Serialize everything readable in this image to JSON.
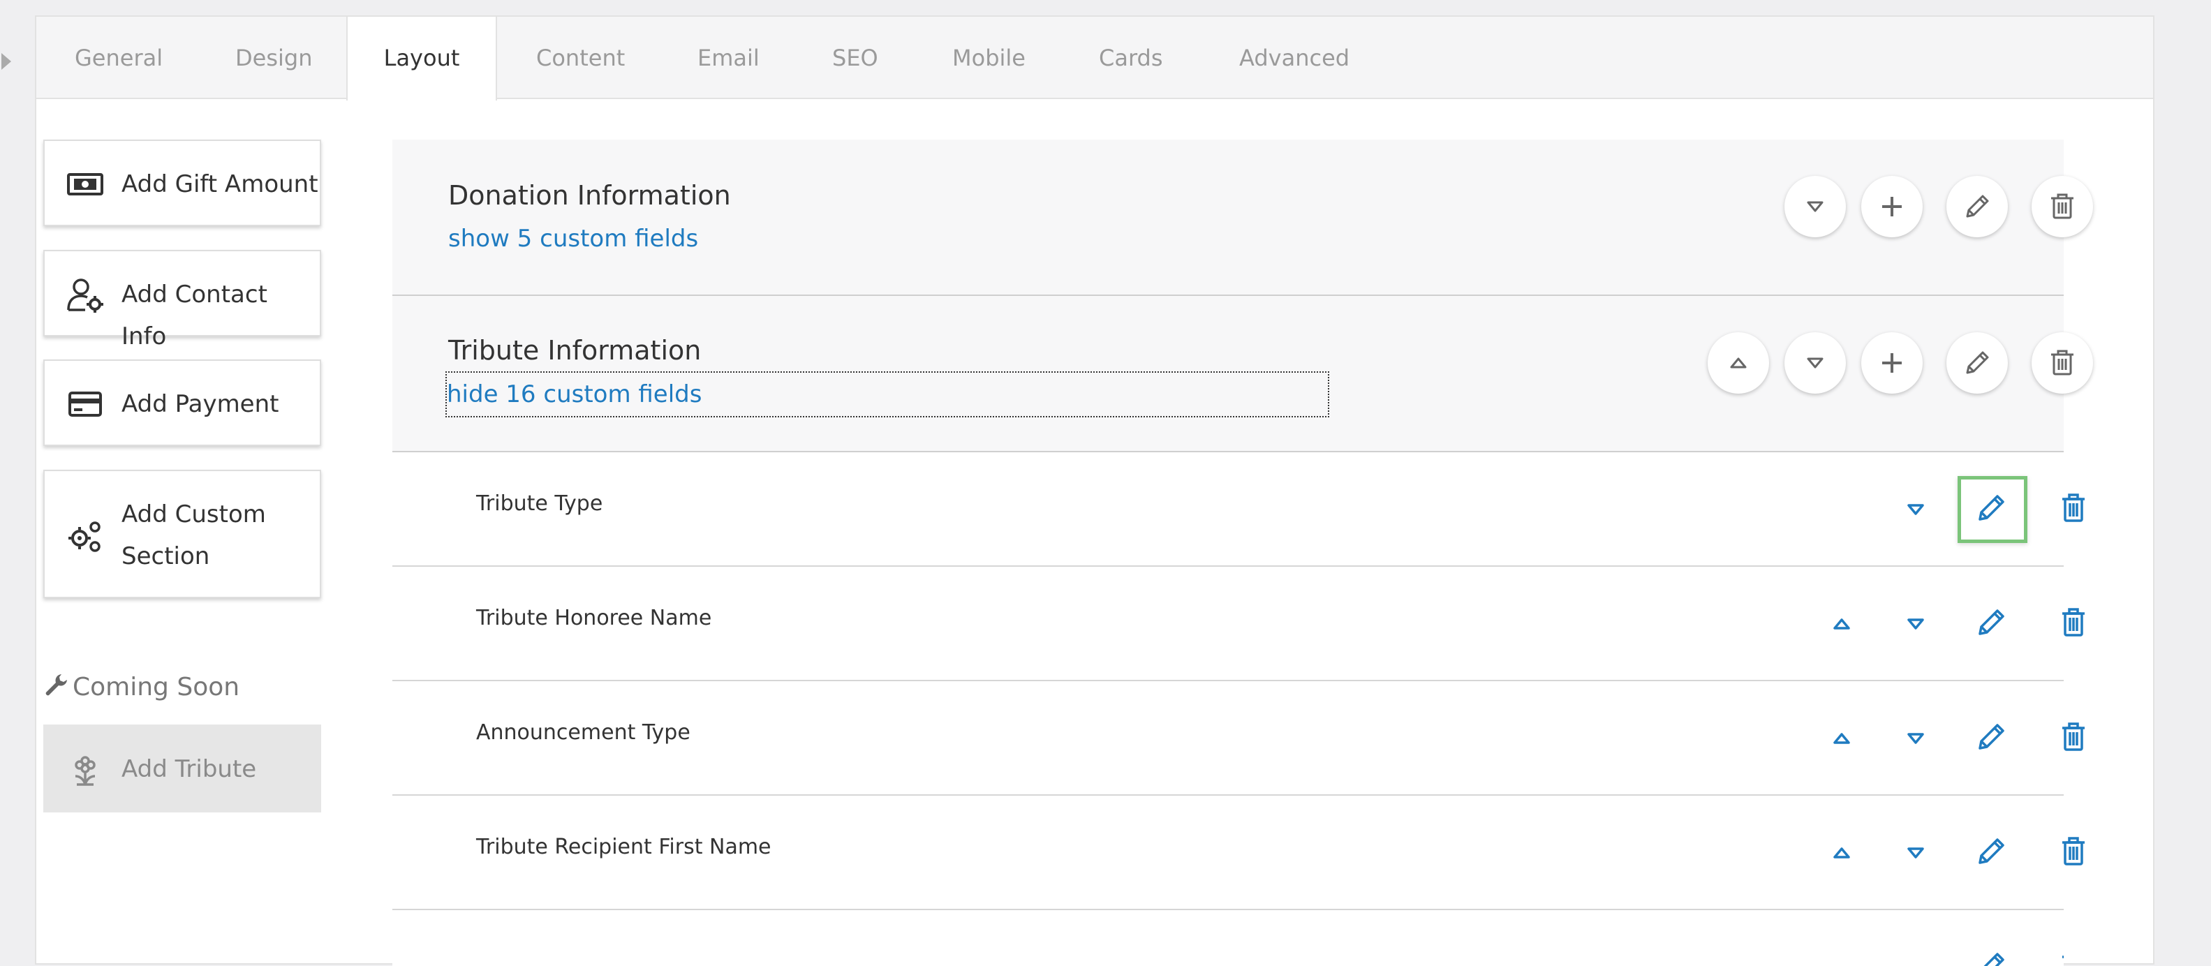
{
  "tabs": [
    {
      "label": "General"
    },
    {
      "label": "Design"
    },
    {
      "label": "Layout",
      "active": true
    },
    {
      "label": "Content"
    },
    {
      "label": "Email"
    },
    {
      "label": "SEO"
    },
    {
      "label": "Mobile"
    },
    {
      "label": "Cards"
    },
    {
      "label": "Advanced"
    }
  ],
  "sidebar": {
    "buttons": [
      {
        "label": "Add Gift Amount",
        "icon": "money-bill-icon"
      },
      {
        "label": "Add Contact Info",
        "icon": "user-gear-icon"
      },
      {
        "label": "Add Payment",
        "icon": "credit-card-icon"
      },
      {
        "label": "Add Custom Section",
        "label_line1": "Add Custom",
        "label_line2": "Section",
        "icon": "gears-icon"
      }
    ],
    "coming_soon": {
      "label": "Coming Soon",
      "icon": "wrench-icon"
    },
    "disabled_button": {
      "label": "Add Tribute",
      "icon": "flower-icon"
    }
  },
  "sections": [
    {
      "title": "Donation Information",
      "link": "show 5 custom fields"
    },
    {
      "title": "Tribute Information",
      "link": "hide 16 custom fields"
    }
  ],
  "fields": [
    {
      "name": "Tribute Type"
    },
    {
      "name": "Tribute Honoree Name"
    },
    {
      "name": "Announcement Type"
    },
    {
      "name": "Tribute Recipient First Name"
    }
  ],
  "colors": {
    "link": "#1f7bc0",
    "highlight": "#7bc47a",
    "section_bg": "#f7f7f8"
  }
}
